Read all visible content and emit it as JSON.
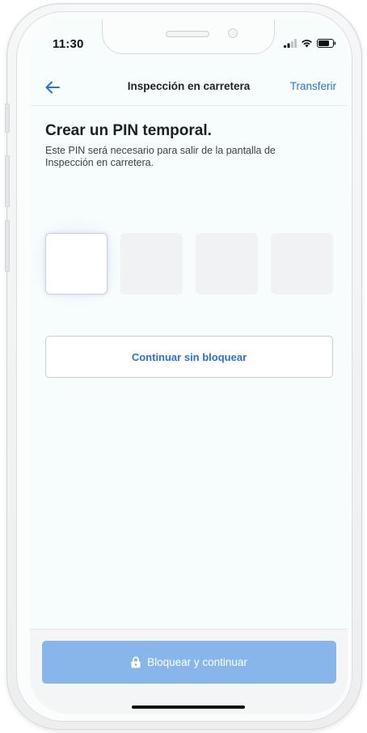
{
  "status_bar": {
    "time": "11:30",
    "icons": [
      "signal-icon",
      "wifi-icon",
      "battery-icon"
    ]
  },
  "nav": {
    "back_icon": "arrow-left-icon",
    "title": "Inspección en carretera",
    "action_label": "Transferir"
  },
  "content": {
    "heading": "Crear un PIN temporal.",
    "description": "Este PIN será necesario para salir de la pantalla de Inspección en carretera.",
    "pin_digits": [
      "",
      "",
      "",
      ""
    ],
    "active_pin_index": 0,
    "continue_without_lock_label": "Continuar sin bloquear"
  },
  "footer": {
    "lock_icon": "lock-icon",
    "primary_label": "Bloquear y continuar"
  },
  "colors": {
    "accent": "#2a72d6",
    "primary_button_disabled": "#88b5ea",
    "screen_background": "#f7fdfd"
  }
}
